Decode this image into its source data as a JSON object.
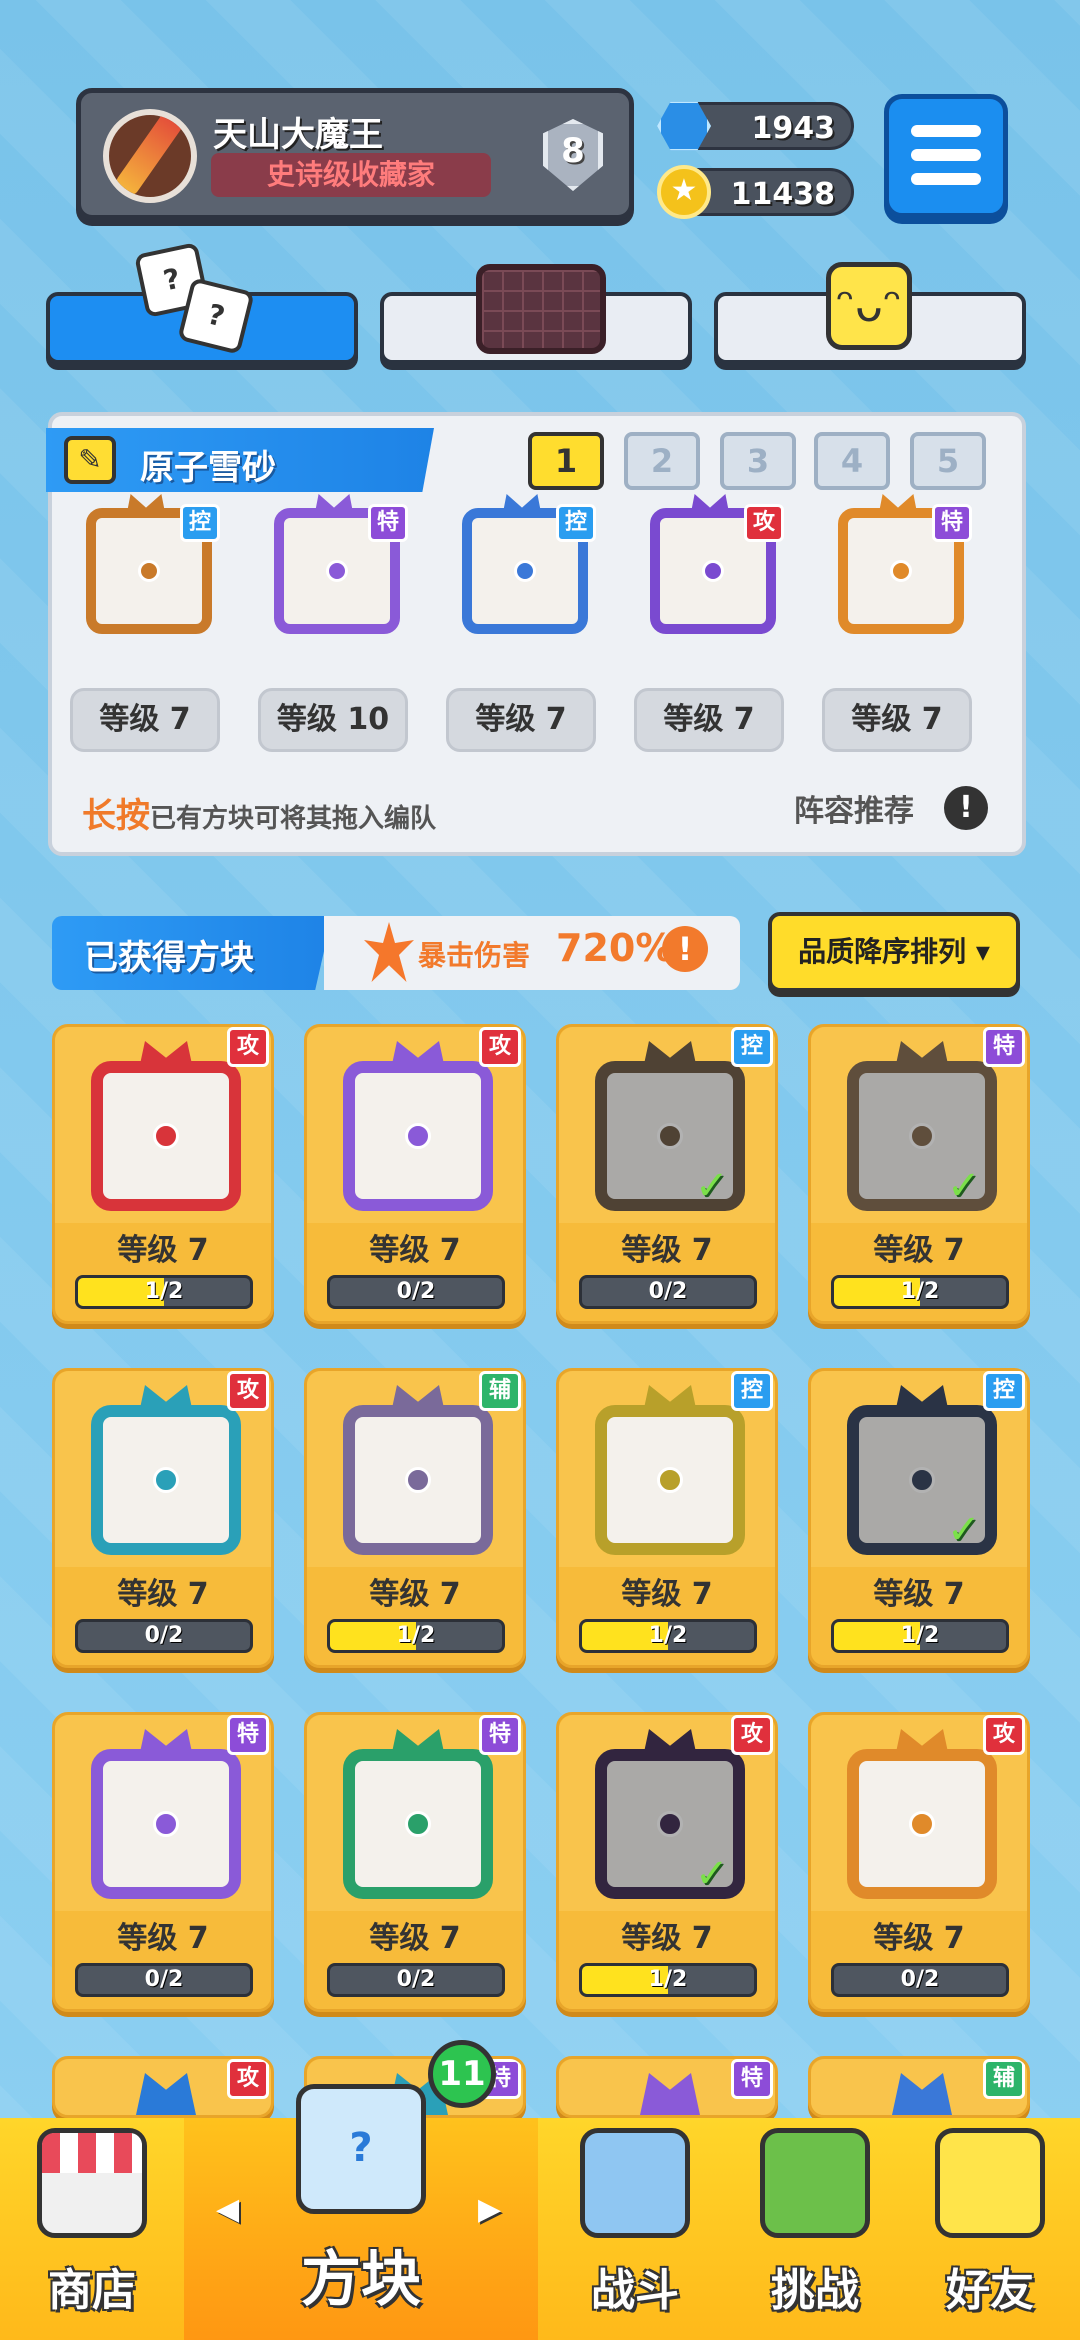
{
  "player": {
    "name": "天山大魔王",
    "title": "史诗级收藏家",
    "rank": "8"
  },
  "currency": {
    "gems": "1943",
    "coins": "11438"
  },
  "icons": {
    "menu": "menu-icon",
    "gem": "gem-icon",
    "coin": "coin-icon"
  },
  "lineup": {
    "title": "原子雪砂",
    "slots": [
      "1",
      "2",
      "3",
      "4",
      "5"
    ],
    "active_slot": 1,
    "cards": [
      {
        "tag": "控",
        "level": "等级 7",
        "color": "#c97a2a"
      },
      {
        "tag": "特",
        "level": "等级 10",
        "color": "#8a5ad8"
      },
      {
        "tag": "控",
        "level": "等级 7",
        "color": "#3a78d8"
      },
      {
        "tag": "攻",
        "level": "等级 7",
        "color": "#7a4ad0"
      },
      {
        "tag": "特",
        "level": "等级 7",
        "color": "#e08a2a"
      }
    ],
    "hint_highlight": "长按",
    "hint_text": "已有方块可将其拖入编队",
    "recommend": "阵容推荐",
    "recommend_icon": "!"
  },
  "owned": {
    "title": "已获得方块",
    "crit_label": "暴击伤害",
    "crit_value": "720%",
    "crit_icon": "!",
    "sort_label": "品质降序排列 ▾"
  },
  "grid": [
    {
      "tag": "攻",
      "level": "等级 7",
      "progress": "1/2",
      "fill": 0.5,
      "color": "#d8343a",
      "dim": false,
      "check": false
    },
    {
      "tag": "攻",
      "level": "等级 7",
      "progress": "0/2",
      "fill": 0,
      "color": "#8a5ad8",
      "dim": false,
      "check": false
    },
    {
      "tag": "控",
      "level": "等级 7",
      "progress": "0/2",
      "fill": 0,
      "color": "#8a5a2a",
      "dim": true,
      "check": true
    },
    {
      "tag": "特",
      "level": "等级 7",
      "progress": "1/2",
      "fill": 0.5,
      "color": "#a86a2a",
      "dim": true,
      "check": true
    },
    {
      "tag": "攻",
      "level": "等级 7",
      "progress": "0/2",
      "fill": 0,
      "color": "#2aa0b8",
      "dim": false,
      "check": false
    },
    {
      "tag": "辅",
      "level": "等级 7",
      "progress": "1/2",
      "fill": 0.5,
      "color": "#7a6a9a",
      "dim": false,
      "check": false
    },
    {
      "tag": "控",
      "level": "等级 7",
      "progress": "1/2",
      "fill": 0.5,
      "color": "#b8a02a",
      "dim": false,
      "check": false
    },
    {
      "tag": "控",
      "level": "等级 7",
      "progress": "1/2",
      "fill": 0.5,
      "color": "#2a4a8a",
      "dim": true,
      "check": true
    },
    {
      "tag": "特",
      "level": "等级 7",
      "progress": "0/2",
      "fill": 0,
      "color": "#8a5ad8",
      "dim": false,
      "check": false
    },
    {
      "tag": "特",
      "level": "等级 7",
      "progress": "0/2",
      "fill": 0,
      "color": "#2aa06a",
      "dim": false,
      "check": false
    },
    {
      "tag": "攻",
      "level": "等级 7",
      "progress": "1/2",
      "fill": 0.5,
      "color": "#5a2a8a",
      "dim": true,
      "check": true
    },
    {
      "tag": "攻",
      "level": "等级 7",
      "progress": "0/2",
      "fill": 0,
      "color": "#e08a2a",
      "dim": false,
      "check": false
    }
  ],
  "partial_row_tags": [
    "攻",
    "特",
    "特",
    "辅"
  ],
  "nav": {
    "items": [
      "商店",
      "方块",
      "战斗",
      "挑战",
      "好友"
    ],
    "badge": "11",
    "arrow_left": "◀",
    "arrow_right": "▶"
  }
}
